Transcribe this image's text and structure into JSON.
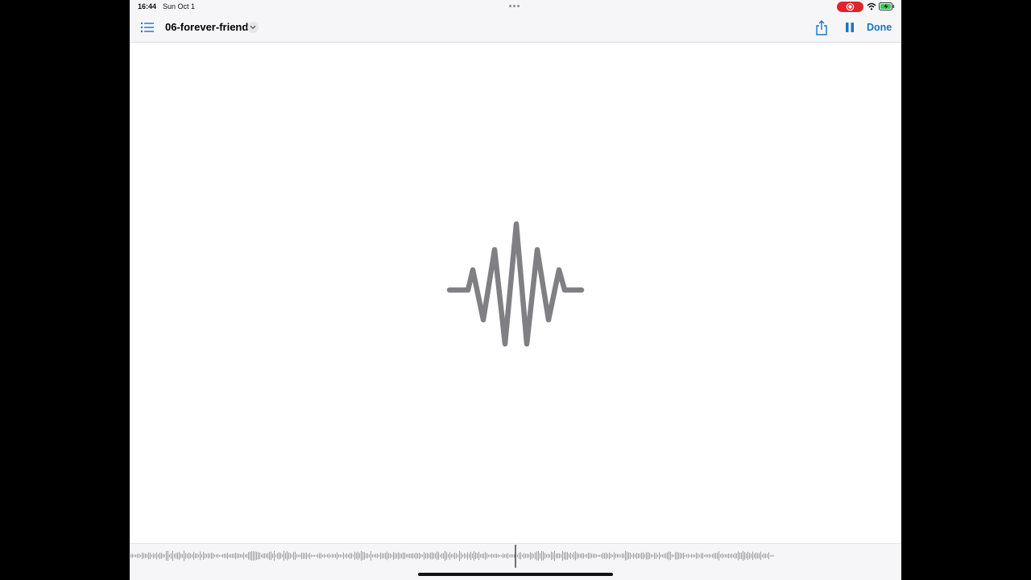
{
  "status_bar": {
    "time": "16:44",
    "date": "Sun Oct 1",
    "icons": [
      "multitask-dots-icon",
      "screen-record-icon",
      "wifi-icon",
      "battery-charging-icon"
    ]
  },
  "nav": {
    "doc_title": "06-forever-friend",
    "done_label": "Done",
    "icons": [
      "list-icon",
      "chevron-down-icon",
      "share-icon",
      "pause-icon"
    ]
  },
  "player": {
    "center_icon": "waveform-icon",
    "state": "playing"
  },
  "scrubber": {
    "playhead_progress": 0.5
  },
  "colors": {
    "accent": "#1a73c6",
    "record": "#e0242b",
    "glyph": "#808084",
    "waveform": "#9a9a9e"
  }
}
